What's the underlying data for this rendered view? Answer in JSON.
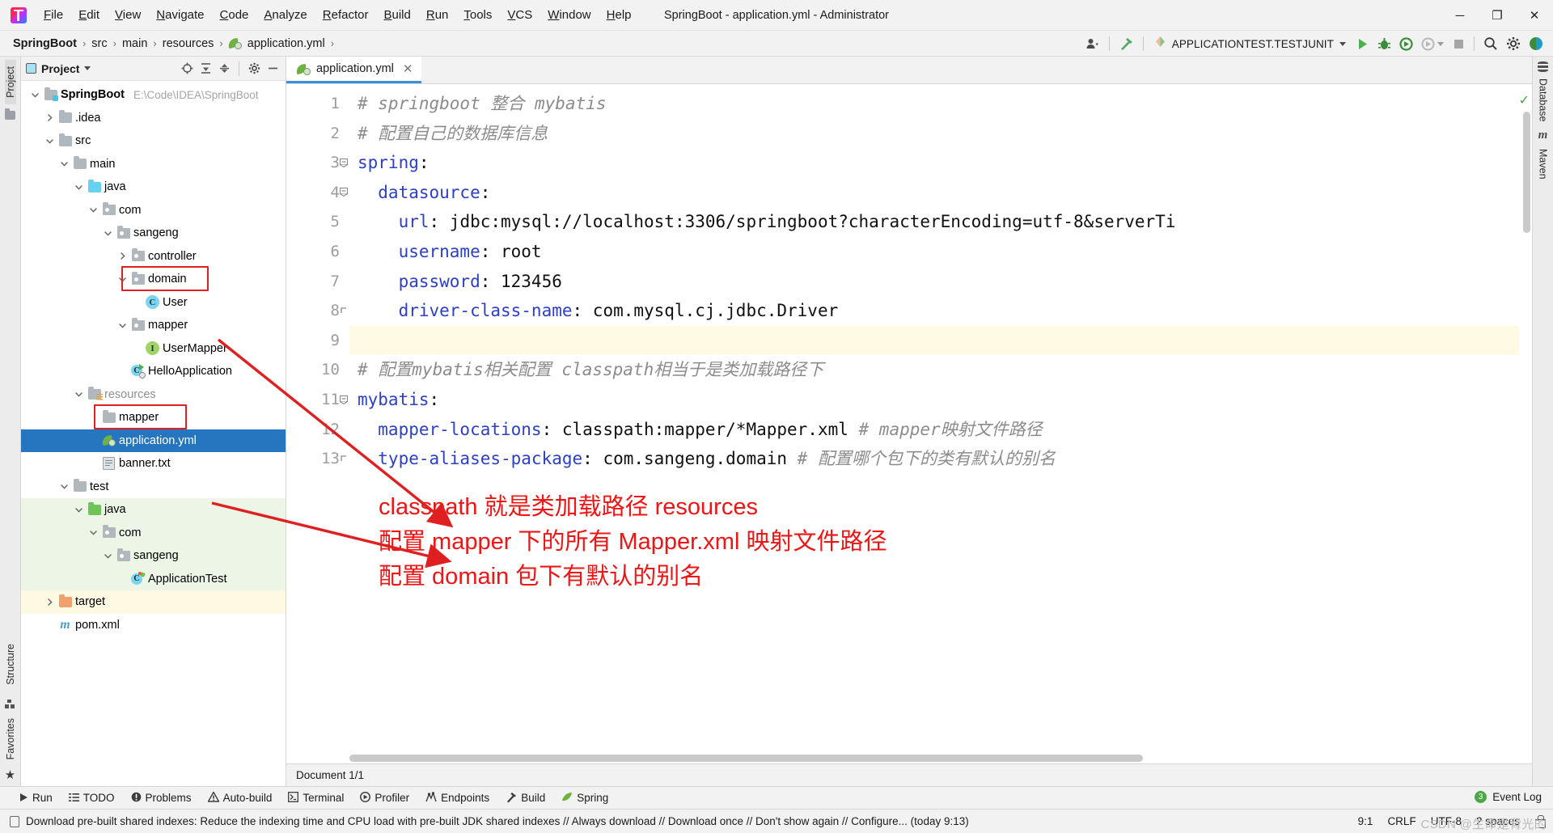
{
  "window": {
    "title": "SpringBoot - application.yml - Administrator",
    "minimize": "─",
    "maximize": "❐",
    "close": "✕"
  },
  "menu": [
    {
      "label": "File"
    },
    {
      "label": "Edit"
    },
    {
      "label": "View"
    },
    {
      "label": "Navigate"
    },
    {
      "label": "Code"
    },
    {
      "label": "Analyze"
    },
    {
      "label": "Refactor"
    },
    {
      "label": "Build"
    },
    {
      "label": "Run"
    },
    {
      "label": "Tools"
    },
    {
      "label": "VCS"
    },
    {
      "label": "Window"
    },
    {
      "label": "Help"
    }
  ],
  "breadcrumb": {
    "items": [
      "SpringBoot",
      "src",
      "main",
      "resources",
      "application.yml"
    ],
    "separator": "›"
  },
  "toolbar": {
    "run_config": "APPLICATIONTEST.TESTJUNIT",
    "icons": [
      "user-dropdown-icon",
      "build-hammer-icon",
      "run-config-icon",
      "run-icon",
      "debug-icon",
      "run-coverage-icon",
      "profile-icon",
      "stop-icon",
      "search-everywhere-icon",
      "settings-gear-icon",
      "ide-theme-icon"
    ]
  },
  "left_strip": {
    "project_tab": "Project",
    "structure_tab": "Structure",
    "favorites_tab": "Favorites"
  },
  "right_strip": {
    "database_tab": "Database",
    "maven_tab": "Maven"
  },
  "project_panel": {
    "title": "Project",
    "tools": [
      "locate-icon",
      "collapse-all-icon",
      "expand-all-icon",
      "settings-gear-icon",
      "hide-icon"
    ],
    "tree": [
      {
        "label": "SpringBoot",
        "path": "E:\\Code\\IDEA\\SpringBoot",
        "indent": 0,
        "arrow": "down",
        "icon": "folder-src",
        "bold": true
      },
      {
        "label": ".idea",
        "indent": 1,
        "arrow": "right",
        "icon": "folder"
      },
      {
        "label": "src",
        "indent": 1,
        "arrow": "down",
        "icon": "folder"
      },
      {
        "label": "main",
        "indent": 2,
        "arrow": "down",
        "icon": "folder"
      },
      {
        "label": "java",
        "indent": 3,
        "arrow": "down",
        "icon": "folder-blue"
      },
      {
        "label": "com",
        "indent": 4,
        "arrow": "down",
        "icon": "package"
      },
      {
        "label": "sangeng",
        "indent": 5,
        "arrow": "down",
        "icon": "package"
      },
      {
        "label": "controller",
        "indent": 6,
        "arrow": "right",
        "icon": "package"
      },
      {
        "label": "domain",
        "indent": 6,
        "arrow": "down",
        "icon": "package",
        "highlight": true
      },
      {
        "label": "User",
        "indent": 7,
        "arrow": "none",
        "icon": "class"
      },
      {
        "label": "mapper",
        "indent": 6,
        "arrow": "down",
        "icon": "package"
      },
      {
        "label": "UserMapper",
        "indent": 7,
        "arrow": "none",
        "icon": "interface"
      },
      {
        "label": "HelloApplication",
        "indent": 6,
        "arrow": "none",
        "icon": "spring-app"
      },
      {
        "label": "resources",
        "indent": 3,
        "arrow": "down",
        "icon": "folder-res",
        "muted": true
      },
      {
        "label": "mapper",
        "indent": 4,
        "arrow": "none",
        "icon": "folder",
        "highlight": true
      },
      {
        "label": "application.yml",
        "indent": 4,
        "arrow": "none",
        "icon": "spring-yml",
        "selected": true
      },
      {
        "label": "banner.txt",
        "indent": 4,
        "arrow": "none",
        "icon": "text-file"
      },
      {
        "label": "test",
        "indent": 2,
        "arrow": "down",
        "icon": "folder"
      },
      {
        "label": "java",
        "indent": 3,
        "arrow": "down",
        "icon": "folder-green",
        "test": true
      },
      {
        "label": "com",
        "indent": 4,
        "arrow": "down",
        "icon": "package",
        "test": true
      },
      {
        "label": "sangeng",
        "indent": 5,
        "arrow": "down",
        "icon": "package",
        "test": true
      },
      {
        "label": "ApplicationTest",
        "indent": 6,
        "arrow": "none",
        "icon": "test-class",
        "test": true
      },
      {
        "label": "target",
        "indent": 1,
        "arrow": "right",
        "icon": "folder-orange",
        "excluded": true
      },
      {
        "label": "pom.xml",
        "indent": 1,
        "arrow": "none",
        "icon": "maven"
      }
    ]
  },
  "editor": {
    "tab": {
      "label": "application.yml",
      "icon": "spring-yml-icon",
      "close": "✕"
    },
    "status": "Document 1/1",
    "lines": [
      {
        "n": 1,
        "tokens": [
          {
            "t": "# springboot 整合 mybatis",
            "c": "com"
          }
        ]
      },
      {
        "n": 2,
        "tokens": [
          {
            "t": "# 配置自己的数据库信息",
            "c": "com"
          }
        ]
      },
      {
        "n": 3,
        "fold": "minus",
        "tokens": [
          {
            "t": "spring",
            "c": "key"
          },
          {
            "t": ":",
            "c": "plain"
          }
        ]
      },
      {
        "n": 4,
        "fold": "minus",
        "tokens": [
          {
            "t": "  datasource",
            "c": "key"
          },
          {
            "t": ":",
            "c": "plain"
          }
        ]
      },
      {
        "n": 5,
        "tokens": [
          {
            "t": "    url",
            "c": "key"
          },
          {
            "t": ": jdbc:mysql://localhost:3306/springboot?characterEncoding=utf-8&serverTi",
            "c": "plain"
          }
        ]
      },
      {
        "n": 6,
        "tokens": [
          {
            "t": "    username",
            "c": "key"
          },
          {
            "t": ": root",
            "c": "plain"
          }
        ]
      },
      {
        "n": 7,
        "tokens": [
          {
            "t": "    password",
            "c": "key"
          },
          {
            "t": ": 123456",
            "c": "plain"
          }
        ]
      },
      {
        "n": 8,
        "fold": "end",
        "tokens": [
          {
            "t": "    driver-class-name",
            "c": "key"
          },
          {
            "t": ": com.mysql.cj.jdbc.Driver",
            "c": "plain"
          }
        ]
      },
      {
        "n": 9,
        "caret": true,
        "tokens": [
          {
            "t": "",
            "c": "plain"
          }
        ]
      },
      {
        "n": 10,
        "tokens": [
          {
            "t": "# 配置mybatis相关配置 classpath相当于是类加载路径下",
            "c": "com"
          }
        ]
      },
      {
        "n": 11,
        "fold": "minus",
        "tokens": [
          {
            "t": "mybatis",
            "c": "key"
          },
          {
            "t": ":",
            "c": "plain"
          }
        ]
      },
      {
        "n": 12,
        "tokens": [
          {
            "t": "  mapper-locations",
            "c": "key"
          },
          {
            "t": ": classpath:mapper/*Mapper.xml ",
            "c": "plain"
          },
          {
            "t": "# mapper映射文件路径",
            "c": "com"
          }
        ]
      },
      {
        "n": 13,
        "fold": "end",
        "tokens": [
          {
            "t": "  type-aliases-package",
            "c": "key"
          },
          {
            "t": ": com.sangeng.domain ",
            "c": "plain"
          },
          {
            "t": "# 配置哪个包下的类有默认的别名",
            "c": "com"
          }
        ]
      }
    ],
    "annotation": [
      "classpath 就是类加载路径 resources",
      "配置 mapper 下的所有 Mapper.xml 映射文件路径",
      "配置 domain 包下有默认的别名"
    ]
  },
  "bottom_tools": [
    {
      "label": "Run",
      "icon": "play-icon"
    },
    {
      "label": "TODO",
      "icon": "list-icon"
    },
    {
      "label": "Problems",
      "icon": "error-icon"
    },
    {
      "label": "Auto-build",
      "icon": "warning-icon"
    },
    {
      "label": "Terminal",
      "icon": "terminal-icon"
    },
    {
      "label": "Profiler",
      "icon": "profiler-icon"
    },
    {
      "label": "Endpoints",
      "icon": "endpoints-icon"
    },
    {
      "label": "Build",
      "icon": "hammer-icon"
    },
    {
      "label": "Spring",
      "icon": "spring-leaf-icon"
    }
  ],
  "statusbar": {
    "message": "Download pre-built shared indexes: Reduce the indexing time and CPU load with pre-built JDK shared indexes // Always download // Download once // Don't show again // Configure... (today 9:13)",
    "caret": "9:1",
    "line_sep": "CRLF",
    "encoding": "UTF-8",
    "indent": "2 spaces",
    "event_log": "Event Log",
    "event_count": "3",
    "watermark": "CSDN @生命是背光的"
  },
  "colors": {
    "accent": "#2675bf",
    "highlight_red": "#e02020",
    "annotation_red": "#f01414",
    "keyword_blue": "#2c3fc9",
    "comment_gray": "#8c8c8c",
    "test_green_bg": "#edf6e6",
    "excluded_yellow_bg": "#fdf9e3"
  }
}
